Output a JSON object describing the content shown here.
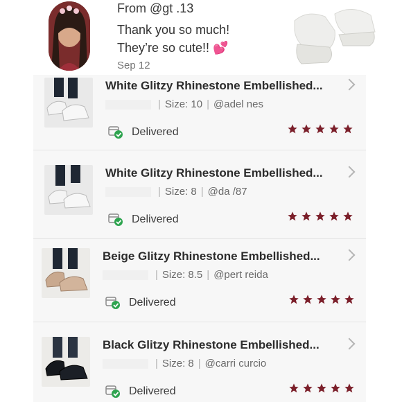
{
  "review": {
    "from": "From @gt  .13",
    "message_line1": "Thank you so much!",
    "message_line2": "They’re so cute!! 💕",
    "date": "Sep 12"
  },
  "orders": [
    {
      "title": "White Glitzy Rhinestone Embellished...",
      "size": "Size: 10",
      "user": "@adel   nes",
      "status": "Delivered",
      "rating": 5
    },
    {
      "title": "White Glitzy Rhinestone Embellished...",
      "size": "Size: 8",
      "user": "@da   /87",
      "status": "Delivered",
      "rating": 5
    },
    {
      "title": "Beige Glitzy Rhinestone Embellished...",
      "size": "Size: 8.5",
      "user": "@pert   reida",
      "status": "Delivered",
      "rating": 5
    },
    {
      "title": "Black Glitzy Rhinestone Embellished...",
      "size": "Size: 8",
      "user": "@carri   curcio",
      "status": "Delivered",
      "rating": 5
    }
  ],
  "colors": {
    "star": "#7b1f2a",
    "delivered_check": "#2ea44f",
    "panel_bg": "#f7f7f7"
  }
}
